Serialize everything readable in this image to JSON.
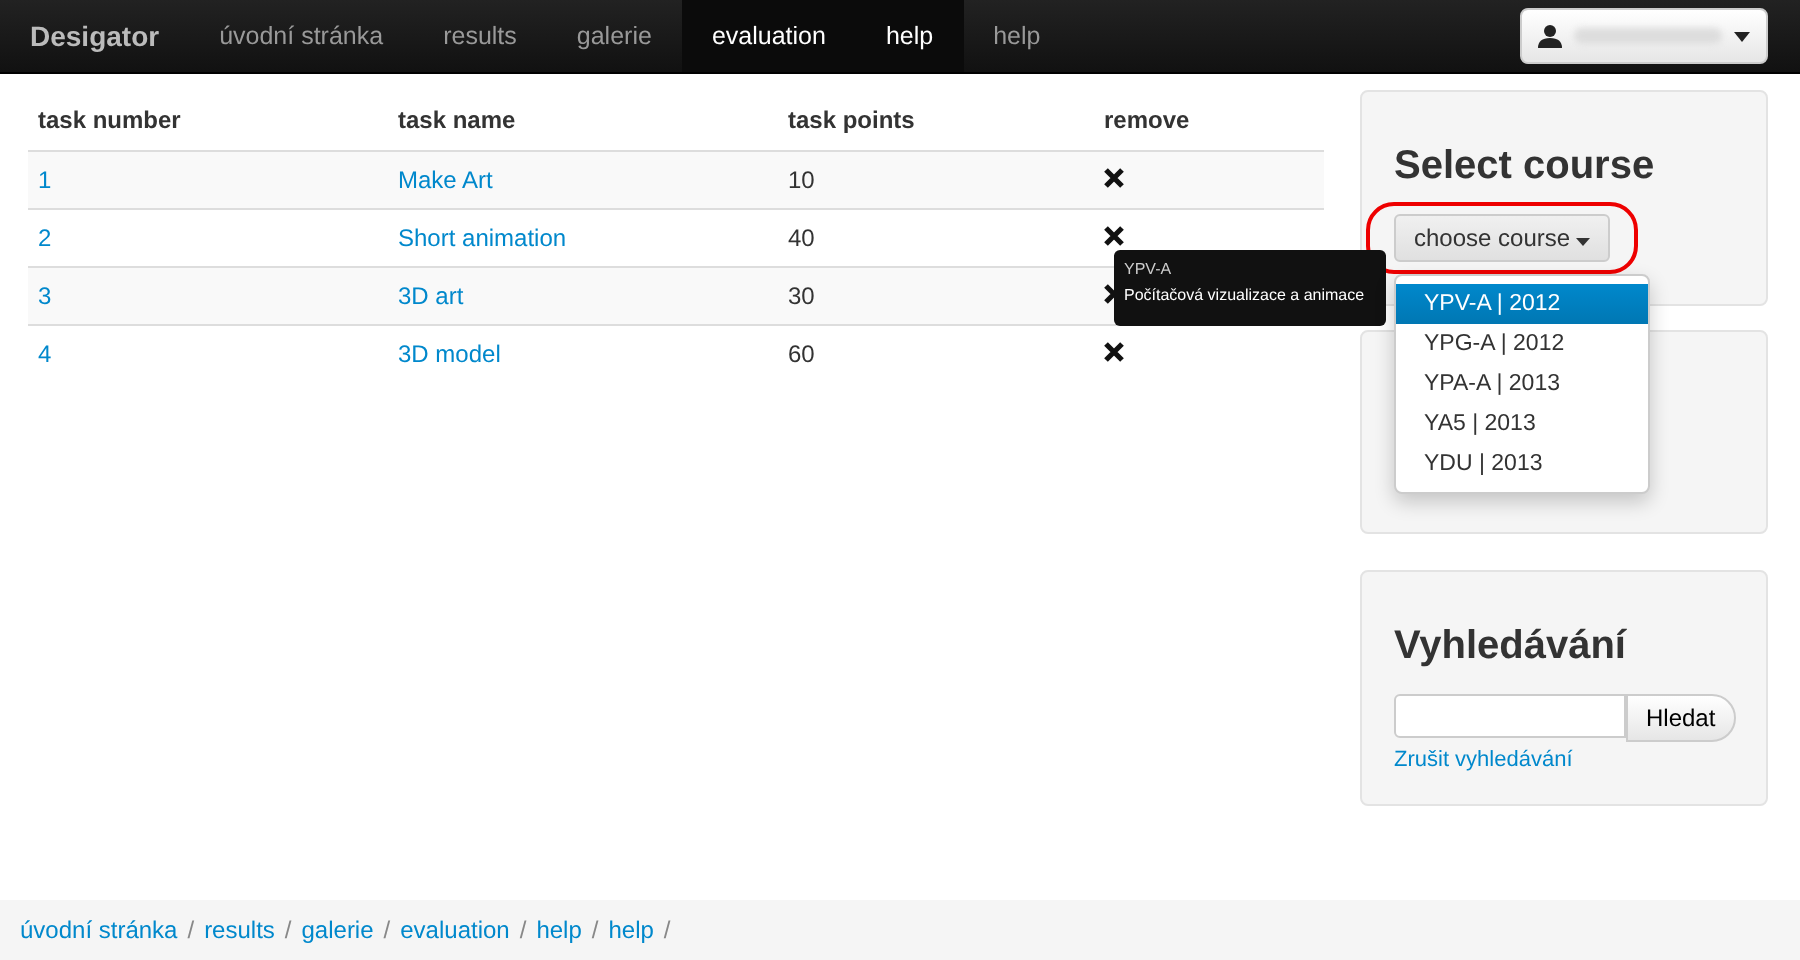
{
  "navbar": {
    "brand": "Desigator",
    "items": [
      {
        "label": "úvodní stránka",
        "selected": false
      },
      {
        "label": "results",
        "selected": false
      },
      {
        "label": "galerie",
        "selected": false
      },
      {
        "label": "evaluation",
        "selected": true
      },
      {
        "label": "help",
        "selected": true
      },
      {
        "label": "help",
        "selected": false
      }
    ]
  },
  "table": {
    "columns": [
      "task number",
      "task name",
      "task points",
      "remove"
    ],
    "rows": [
      {
        "number": "1",
        "name": "Make Art",
        "points": "10"
      },
      {
        "number": "2",
        "name": "Short animation",
        "points": "40"
      },
      {
        "number": "3",
        "name": "3D art",
        "points": "30"
      },
      {
        "number": "4",
        "name": "3D model",
        "points": "60"
      }
    ]
  },
  "tooltip": {
    "title": "YPV-A",
    "text": "Počítačová vizualizace a animace"
  },
  "select_course": {
    "title": "Select course",
    "button": "choose course",
    "options": [
      {
        "label": "YPV-A | 2012",
        "selected": true
      },
      {
        "label": "YPG-A | 2012",
        "selected": false
      },
      {
        "label": "YPA-A | 2013",
        "selected": false
      },
      {
        "label": "YA5 | 2013",
        "selected": false
      },
      {
        "label": "YDU | 2013",
        "selected": false
      }
    ]
  },
  "search": {
    "title": "Vyhledávání",
    "button": "Hledat",
    "cancel_link": "Zrušit vyhledávání"
  },
  "breadcrumb": [
    {
      "label": "úvodní stránka",
      "separator": "/"
    },
    {
      "label": "results",
      "separator": "/"
    },
    {
      "label": "galerie",
      "separator": "/"
    },
    {
      "label": "evaluation",
      "separator": "/"
    },
    {
      "label": "help",
      "separator": "/"
    },
    {
      "label": "help",
      "separator": "/"
    }
  ]
}
